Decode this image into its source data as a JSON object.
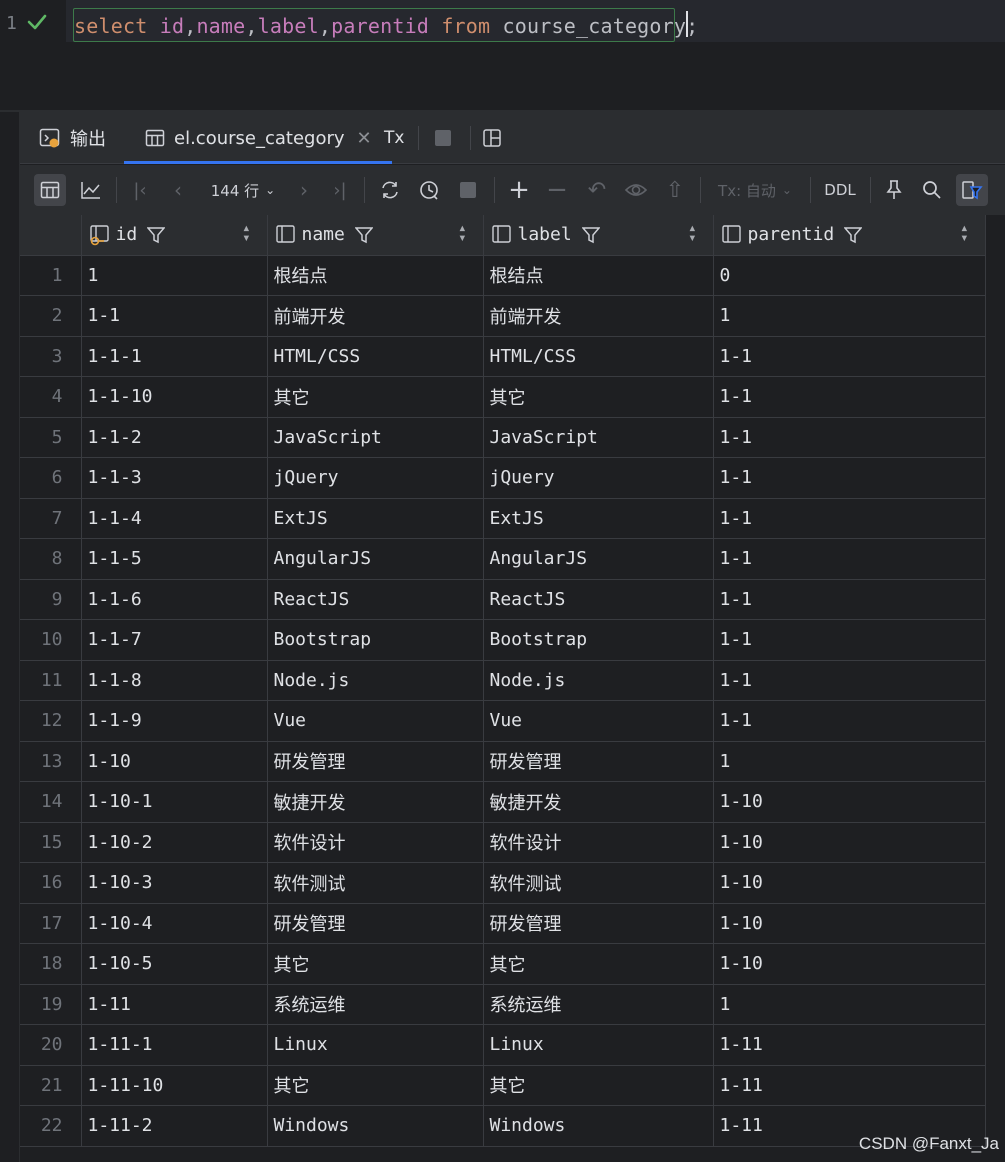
{
  "editor": {
    "line_number": "1",
    "sql": {
      "kw_select": "select",
      "sp1": " ",
      "f_id": "id",
      "c1": ",",
      "f_name": "name",
      "c2": ",",
      "f_label": "label",
      "c3": ",",
      "f_parentid": "parentid",
      "sp2": " ",
      "kw_from": "from",
      "sp3": " ",
      "table": "course_category",
      "semi": ";"
    }
  },
  "tabs": {
    "output": "输出",
    "table": "el.course_category",
    "tx": "Tx"
  },
  "toolbar": {
    "row_count": "144 行",
    "tx_mode": "Tx: 自动",
    "ddl": "DDL"
  },
  "columns": [
    "id",
    "name",
    "label",
    "parentid"
  ],
  "rows": [
    {
      "n": "1",
      "id": "1",
      "name": "根结点",
      "label": "根结点",
      "parentid": "0"
    },
    {
      "n": "2",
      "id": "1-1",
      "name": "前端开发",
      "label": "前端开发",
      "parentid": "1"
    },
    {
      "n": "3",
      "id": "1-1-1",
      "name": "HTML/CSS",
      "label": "HTML/CSS",
      "parentid": "1-1"
    },
    {
      "n": "4",
      "id": "1-1-10",
      "name": "其它",
      "label": "其它",
      "parentid": "1-1"
    },
    {
      "n": "5",
      "id": "1-1-2",
      "name": "JavaScript",
      "label": "JavaScript",
      "parentid": "1-1"
    },
    {
      "n": "6",
      "id": "1-1-3",
      "name": "jQuery",
      "label": "jQuery",
      "parentid": "1-1"
    },
    {
      "n": "7",
      "id": "1-1-4",
      "name": "ExtJS",
      "label": "ExtJS",
      "parentid": "1-1"
    },
    {
      "n": "8",
      "id": "1-1-5",
      "name": "AngularJS",
      "label": "AngularJS",
      "parentid": "1-1"
    },
    {
      "n": "9",
      "id": "1-1-6",
      "name": "ReactJS",
      "label": "ReactJS",
      "parentid": "1-1"
    },
    {
      "n": "10",
      "id": "1-1-7",
      "name": "Bootstrap",
      "label": "Bootstrap",
      "parentid": "1-1"
    },
    {
      "n": "11",
      "id": "1-1-8",
      "name": "Node.js",
      "label": "Node.js",
      "parentid": "1-1"
    },
    {
      "n": "12",
      "id": "1-1-9",
      "name": "Vue",
      "label": "Vue",
      "parentid": "1-1"
    },
    {
      "n": "13",
      "id": "1-10",
      "name": "研发管理",
      "label": "研发管理",
      "parentid": "1"
    },
    {
      "n": "14",
      "id": "1-10-1",
      "name": "敏捷开发",
      "label": "敏捷开发",
      "parentid": "1-10"
    },
    {
      "n": "15",
      "id": "1-10-2",
      "name": "软件设计",
      "label": "软件设计",
      "parentid": "1-10"
    },
    {
      "n": "16",
      "id": "1-10-3",
      "name": "软件测试",
      "label": "软件测试",
      "parentid": "1-10"
    },
    {
      "n": "17",
      "id": "1-10-4",
      "name": "研发管理",
      "label": "研发管理",
      "parentid": "1-10"
    },
    {
      "n": "18",
      "id": "1-10-5",
      "name": "其它",
      "label": "其它",
      "parentid": "1-10"
    },
    {
      "n": "19",
      "id": "1-11",
      "name": "系统运维",
      "label": "系统运维",
      "parentid": "1"
    },
    {
      "n": "20",
      "id": "1-11-1",
      "name": "Linux",
      "label": "Linux",
      "parentid": "1-11"
    },
    {
      "n": "21",
      "id": "1-11-10",
      "name": "其它",
      "label": "其它",
      "parentid": "1-11"
    },
    {
      "n": "22",
      "id": "1-11-2",
      "name": "Windows",
      "label": "Windows",
      "parentid": "1-11"
    }
  ],
  "watermark": "CSDN @Fanxt_Ja",
  "colors": {
    "keyword": "#cf8e6d",
    "field": "#c77dbb",
    "accent": "#3574f0",
    "success": "#5fb865"
  }
}
